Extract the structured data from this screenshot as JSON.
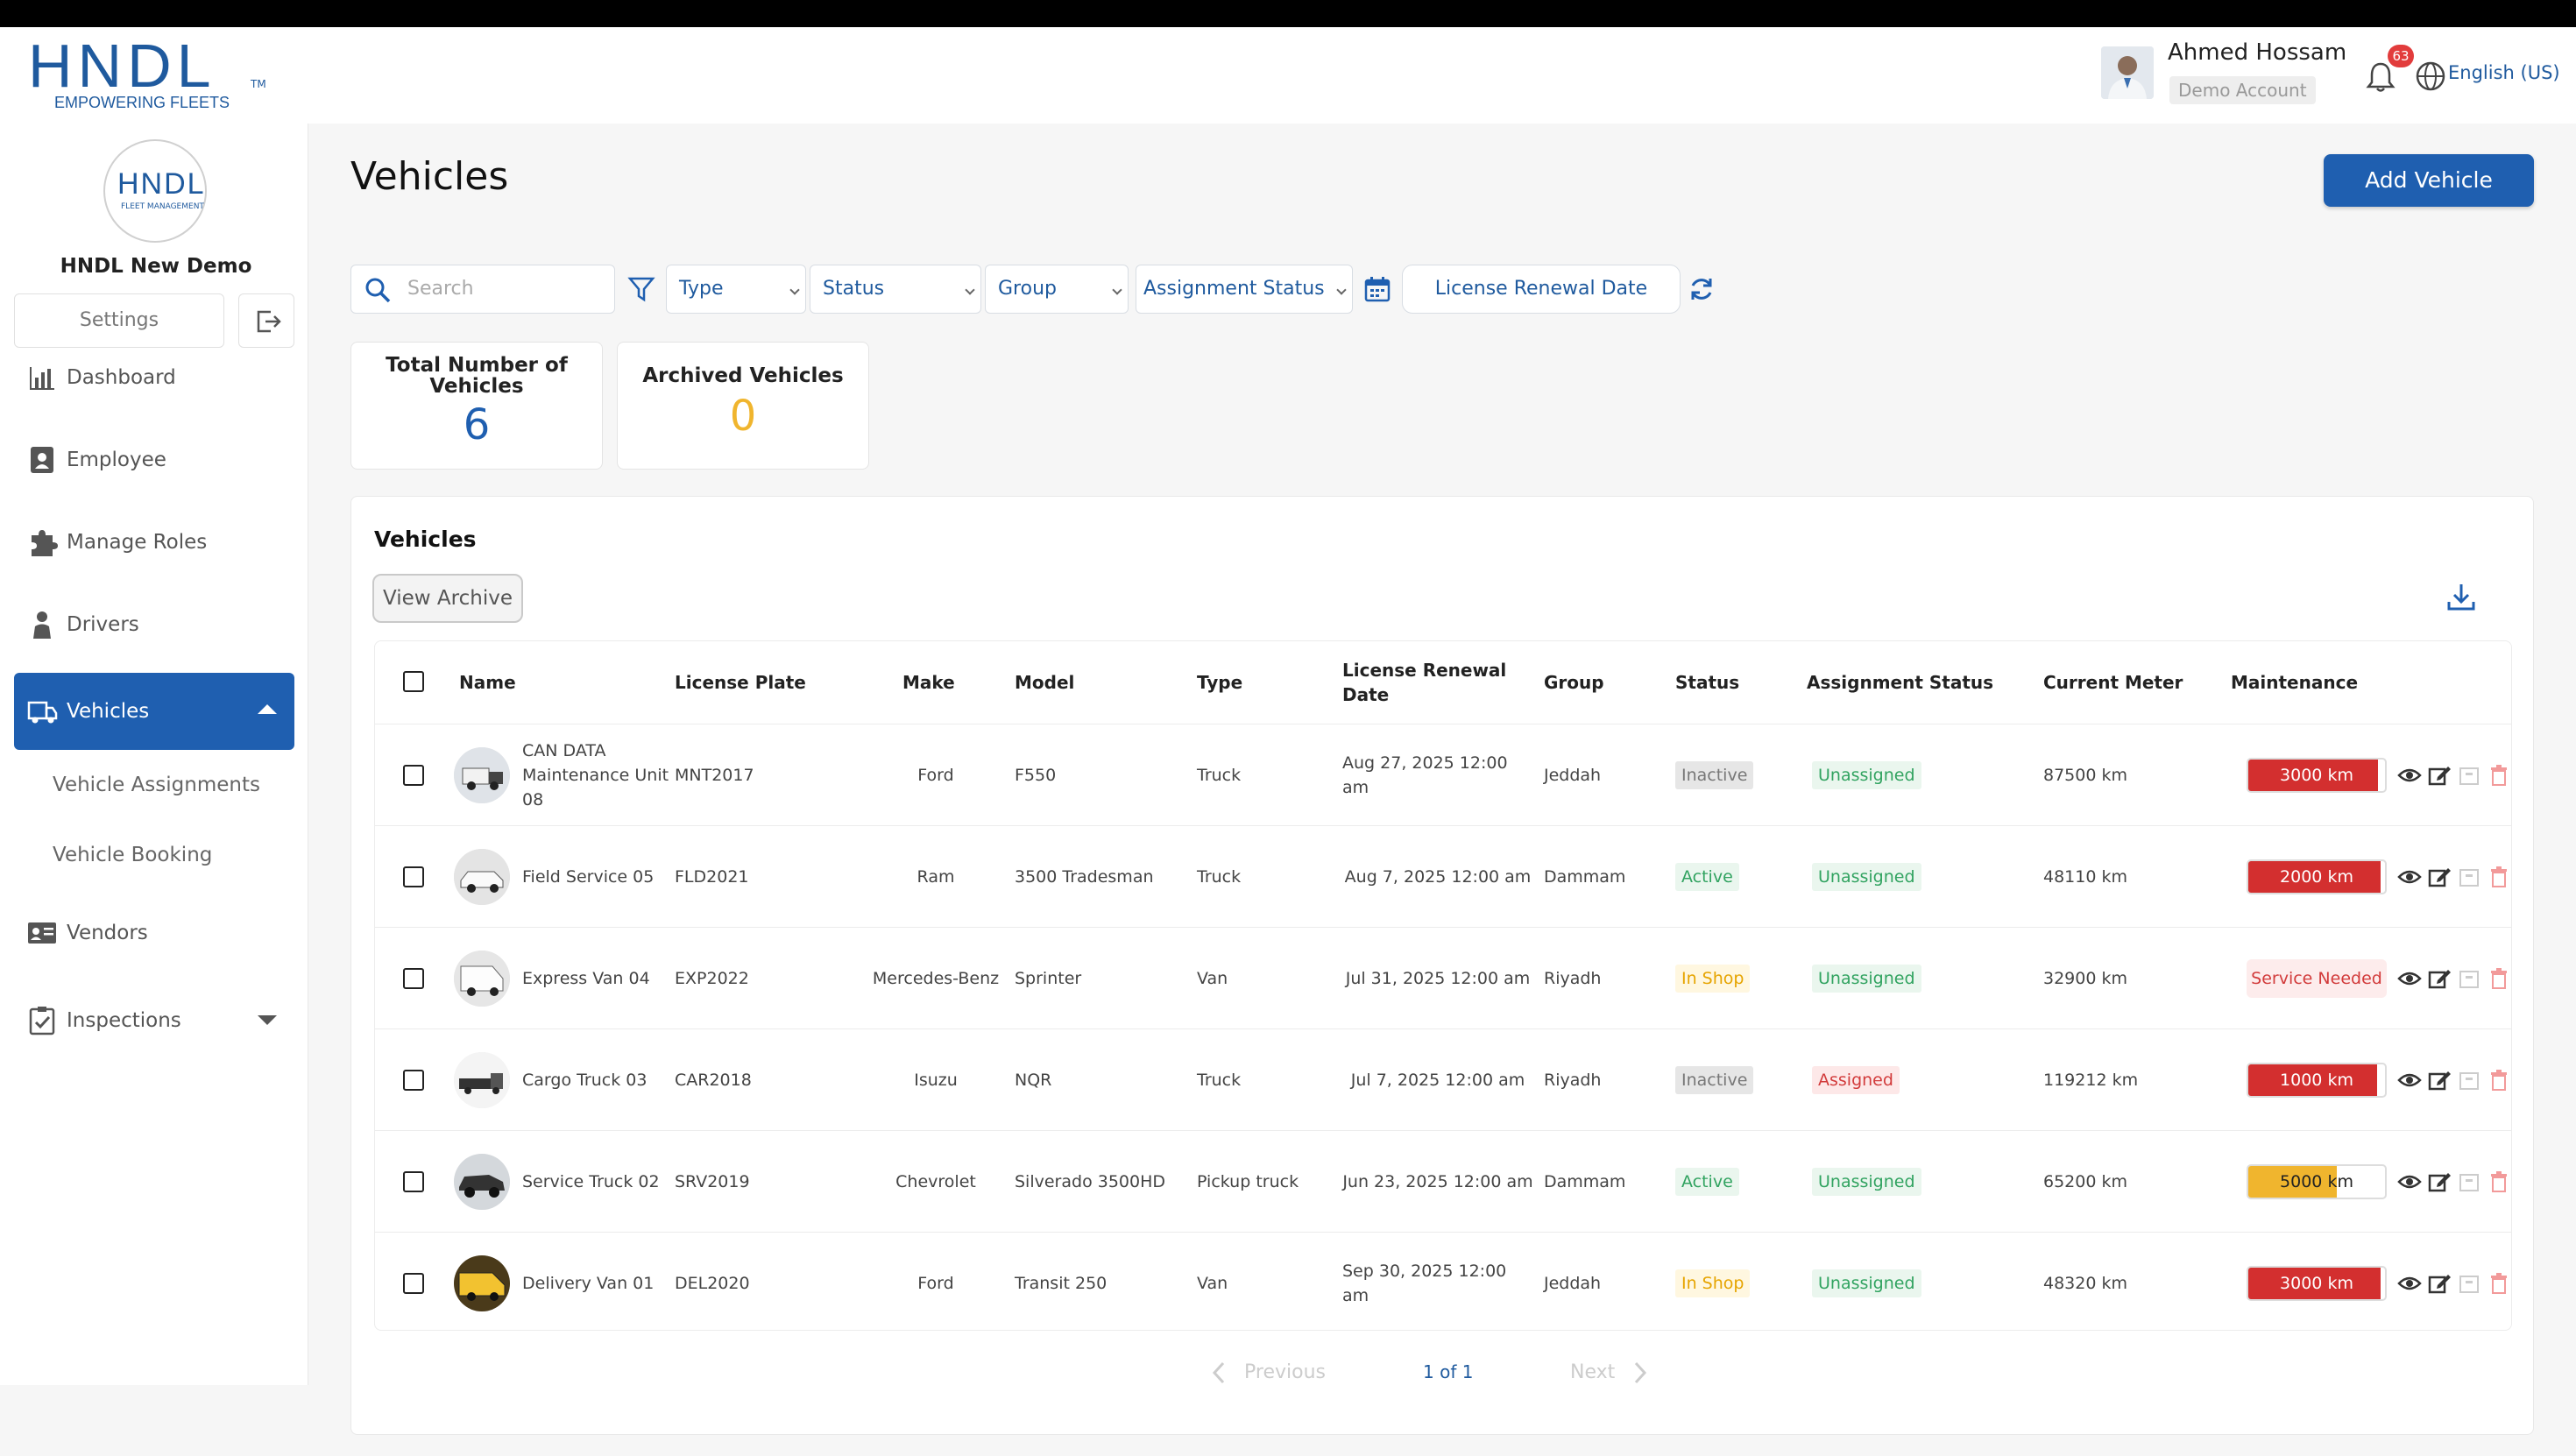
{
  "brand": {
    "logo_text": "HNDL",
    "tagline": "EMPOWERING FLEETS",
    "org_logo_text": "HNDL",
    "org_logo_sub": "FLEET MANAGEMENT"
  },
  "header": {
    "user_name": "Ahmed Hossam",
    "user_role": "Demo Account",
    "notifications_count": "63",
    "language": "English (US)"
  },
  "sidebar": {
    "org_name": "HNDL New Demo",
    "settings_label": "Settings",
    "items": [
      {
        "label": "Dashboard",
        "icon": "chart-bar-icon"
      },
      {
        "label": "Employee",
        "icon": "id-badge-icon"
      },
      {
        "label": "Manage Roles",
        "icon": "puzzle-icon"
      },
      {
        "label": "Drivers",
        "icon": "driver-icon"
      },
      {
        "label": "Vehicles",
        "icon": "truck-icon",
        "active": true
      },
      {
        "label": "Vendors",
        "icon": "vendor-card-icon"
      },
      {
        "label": "Inspections",
        "icon": "clipboard-check-icon"
      }
    ],
    "vehicle_sub": [
      "Vehicle Assignments",
      "Vehicle Booking"
    ]
  },
  "page": {
    "title": "Vehicles",
    "add_button": "Add Vehicle"
  },
  "filters": {
    "search_placeholder": "Search",
    "type": "Type",
    "status": "Status",
    "group": "Group",
    "assignment_status": "Assignment Status",
    "license_renewal_date": "License Renewal Date"
  },
  "stats": {
    "total_label": "Total Number of Vehicles",
    "total_value": "6",
    "archived_label": "Archived Vehicles",
    "archived_value": "0"
  },
  "table": {
    "title": "Vehicles",
    "view_archive": "View Archive",
    "columns": [
      "Name",
      "License Plate",
      "Make",
      "Model",
      "Type",
      "License Renewal Date",
      "Group",
      "Status",
      "Assignment Status",
      "Current Meter",
      "Maintenance"
    ],
    "rows": [
      {
        "name": "CAN DATA Maintenance Unit 08",
        "plate": "MNT2017",
        "make": "Ford",
        "model": "F550",
        "type": "Truck",
        "renewal": "Aug 27, 2025 12:00 am",
        "group": "Jeddah",
        "status": "Inactive",
        "assignment": "Unassigned",
        "meter": "87500 km",
        "maintenance": "3000 km",
        "maint_fill": 0.95,
        "maint_color": "#d32f2f"
      },
      {
        "name": "Field Service 05",
        "plate": "FLD2021",
        "make": "Ram",
        "model": "3500 Tradesman",
        "type": "Truck",
        "renewal": "Aug 7, 2025 12:00 am",
        "group": "Dammam",
        "status": "Active",
        "assignment": "Unassigned",
        "meter": "48110 km",
        "maintenance": "2000 km",
        "maint_fill": 0.97,
        "maint_color": "#d32f2f"
      },
      {
        "name": "Express Van 04",
        "plate": "EXP2022",
        "make": "Mercedes-Benz",
        "model": "Sprinter",
        "type": "Van",
        "renewal": "Jul 31, 2025 12:00 am",
        "group": "Riyadh",
        "status": "In Shop",
        "assignment": "Unassigned",
        "meter": "32900 km",
        "maintenance": "Service Needed",
        "maint_fill": null,
        "maint_color": "#d23b3b"
      },
      {
        "name": "Cargo Truck 03",
        "plate": "CAR2018",
        "make": "Isuzu",
        "model": "NQR",
        "type": "Truck",
        "renewal": "Jul 7, 2025 12:00 am",
        "group": "Riyadh",
        "status": "Inactive",
        "assignment": "Assigned",
        "meter": "119212 km",
        "maintenance": "1000 km",
        "maint_fill": 0.94,
        "maint_color": "#d32f2f"
      },
      {
        "name": "Service Truck 02",
        "plate": "SRV2019",
        "make": "Chevrolet",
        "model": "Silverado 3500HD",
        "type": "Pickup truck",
        "renewal": "Jun 23, 2025 12:00 am",
        "group": "Dammam",
        "status": "Active",
        "assignment": "Unassigned",
        "meter": "65200 km",
        "maintenance": "5000 km",
        "maint_fill": 0.65,
        "maint_color": "#f0b52e"
      },
      {
        "name": "Delivery Van 01",
        "plate": "DEL2020",
        "make": "Ford",
        "model": "Transit 250",
        "type": "Van",
        "renewal": "Sep 30, 2025 12:00 am",
        "group": "Jeddah",
        "status": "In Shop",
        "assignment": "Unassigned",
        "meter": "48320 km",
        "maintenance": "3000 km",
        "maint_fill": 0.97,
        "maint_color": "#d32f2f"
      }
    ]
  },
  "pagination": {
    "previous": "Previous",
    "info": "1 of 1",
    "next": "Next"
  },
  "colors": {
    "primary": "#1f5fb0",
    "brand_text": "#1f5a9e",
    "danger": "#d32f2f",
    "warning": "#f0b52e",
    "success": "#31a360",
    "stat_total": "#1f5fb0",
    "stat_archived": "#f0b52e"
  }
}
